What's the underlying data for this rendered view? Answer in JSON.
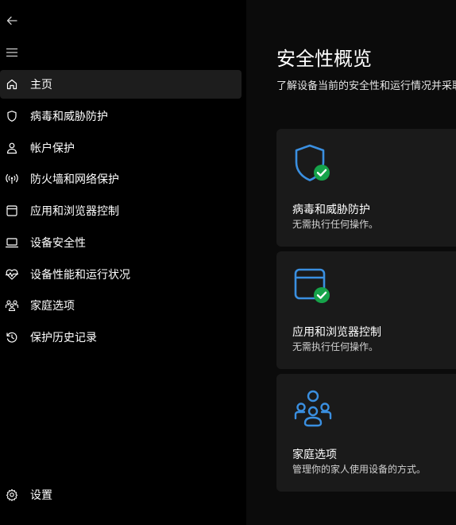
{
  "nav": {
    "back_icon": "back-arrow-icon",
    "menu_icon": "hamburger-menu-icon",
    "items": [
      {
        "label": "主页",
        "icon": "home-icon"
      },
      {
        "label": "病毒和威胁防护",
        "icon": "shield-icon"
      },
      {
        "label": "帐户保护",
        "icon": "person-icon"
      },
      {
        "label": "防火墙和网络保护",
        "icon": "wifi-antenna-icon"
      },
      {
        "label": "应用和浏览器控制",
        "icon": "app-window-icon"
      },
      {
        "label": "设备安全性",
        "icon": "laptop-icon"
      },
      {
        "label": "设备性能和运行状况",
        "icon": "heart-pulse-icon"
      },
      {
        "label": "家庭选项",
        "icon": "family-icon"
      },
      {
        "label": "保护历史记录",
        "icon": "history-icon"
      }
    ],
    "settings_label": "设置",
    "settings_icon": "gear-icon"
  },
  "main": {
    "title": "安全性概览",
    "description": "了解设备当前的安全性和运行情况并采取",
    "cards": [
      {
        "title": "病毒和威胁防护",
        "status": "无需执行任何操作。",
        "icon": "shield-check-icon"
      },
      {
        "title": "应用和浏览器控制",
        "status": "无需执行任何操作。",
        "icon": "app-window-check-icon"
      },
      {
        "title": "家庭选项",
        "status": "管理你的家人使用设备的方式。",
        "icon": "family-icon"
      }
    ]
  },
  "colors": {
    "accent_blue": "#3a8fe0",
    "check_green": "#16a34a",
    "card_bg": "#1a1a1a",
    "active_bg": "#1d1d1d"
  }
}
